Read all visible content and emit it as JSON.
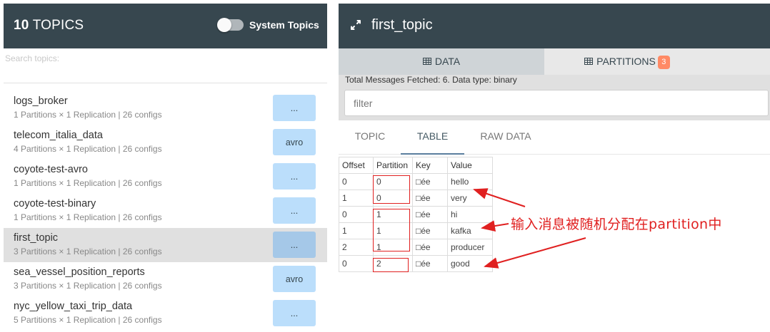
{
  "left_panel": {
    "header": {
      "count": "10",
      "title": "TOPICS",
      "system_topics_label": "System Topics"
    },
    "search": {
      "placeholder": "Search topics:"
    },
    "topics": [
      {
        "name": "logs_broker",
        "meta": "1 Partitions × 1 Replication | 26 configs",
        "button": "..."
      },
      {
        "name": "telecom_italia_data",
        "meta": "4 Partitions × 1 Replication | 26 configs",
        "button": "avro"
      },
      {
        "name": "coyote-test-avro",
        "meta": "1 Partitions × 1 Replication | 26 configs",
        "button": "..."
      },
      {
        "name": "coyote-test-binary",
        "meta": "1 Partitions × 1 Replication | 26 configs",
        "button": "..."
      },
      {
        "name": "first_topic",
        "meta": "3 Partitions × 1 Replication | 26 configs",
        "button": "...",
        "selected": true
      },
      {
        "name": "sea_vessel_position_reports",
        "meta": "3 Partitions × 1 Replication | 26 configs",
        "button": "avro"
      },
      {
        "name": "nyc_yellow_taxi_trip_data",
        "meta": "5 Partitions × 1 Replication | 26 configs",
        "button": "..."
      }
    ]
  },
  "right_panel": {
    "title": "first_topic",
    "tabs": {
      "data": "DATA",
      "partitions": "PARTITIONS",
      "partitions_badge": "3"
    },
    "info": "Total Messages Fetched: 6. Data type: binary",
    "filter": {
      "placeholder": "filter"
    },
    "subtabs": [
      "TOPIC",
      "TABLE",
      "RAW DATA"
    ],
    "table": {
      "headers": [
        "Offset",
        "Partition",
        "Key",
        "Value"
      ],
      "rows": [
        [
          "0",
          "0",
          "□ée",
          "hello"
        ],
        [
          "1",
          "0",
          "□ée",
          "very"
        ],
        [
          "0",
          "1",
          "□ée",
          "hi"
        ],
        [
          "1",
          "1",
          "□ée",
          "kafka"
        ],
        [
          "2",
          "1",
          "□ée",
          "producer"
        ],
        [
          "0",
          "2",
          "□ée",
          "good"
        ]
      ]
    }
  },
  "annotation": {
    "text": "输入消息被随机分配在partition中",
    "color": "#e02020"
  },
  "colors": {
    "header_bg": "#37474f",
    "button_bg": "#bbdefb",
    "badge": "#ff8a65"
  }
}
